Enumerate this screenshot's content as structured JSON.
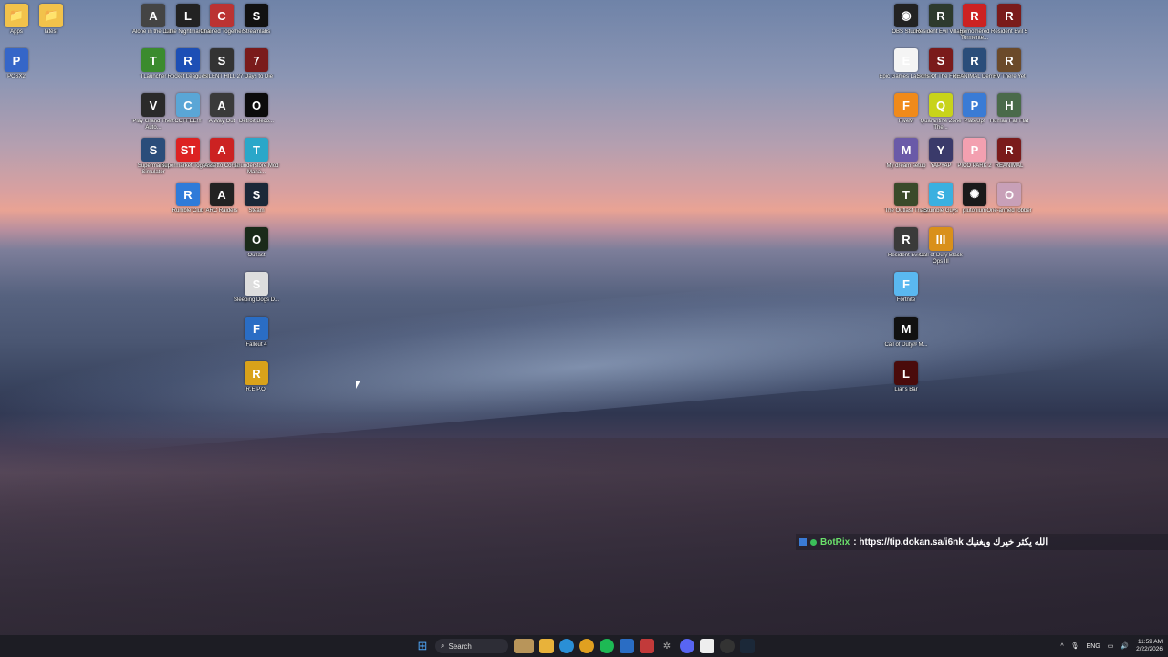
{
  "desktop": {
    "icons": [
      {
        "label": "Apps",
        "col": "#f2c24b",
        "glyph": "📁"
      },
      {
        "label": "latest",
        "col": "#f2c24b",
        "glyph": "📁"
      },
      {
        "label": "PCSX2",
        "col": "#3566c8",
        "glyph": "P"
      },
      {
        "label": "Alone in the Dark",
        "col": "#444",
        "glyph": "A"
      },
      {
        "label": "Little Nightmares II",
        "col": "#222",
        "glyph": "L"
      },
      {
        "label": "Chained Together",
        "col": "#b33",
        "glyph": "C"
      },
      {
        "label": "Streamlabs",
        "col": "#111",
        "glyph": "S"
      },
      {
        "label": "TLauncher",
        "col": "#3b8b2e",
        "glyph": "T"
      },
      {
        "label": "Rocket League®",
        "col": "#1d4fb5",
        "glyph": "R"
      },
      {
        "label": "SILENT HILL 2",
        "col": "#333",
        "glyph": "S"
      },
      {
        "label": "7 Days to Die",
        "col": "#7a1b1b",
        "glyph": "7"
      },
      {
        "label": "Play Grand Theft Auto...",
        "col": "#2a2a2a",
        "glyph": "V"
      },
      {
        "label": "COFFEE!!!",
        "col": "#5aa6d6",
        "glyph": "C"
      },
      {
        "label": "A Way Out",
        "col": "#3a3a3a",
        "glyph": "A"
      },
      {
        "label": "Detroit Beco...",
        "col": "#0b0b0b",
        "glyph": "O"
      },
      {
        "label": "Supermarket Simulator",
        "col": "#2a4d7a",
        "glyph": "S"
      },
      {
        "label": "Supermarket Together",
        "col": "#d22",
        "glyph": "ST"
      },
      {
        "label": "Assetto Corsa",
        "col": "#c22",
        "glyph": "A"
      },
      {
        "label": "Thunderstore Mod Mana...",
        "col": "#2aa7c9",
        "glyph": "T"
      },
      {
        "label": "Rumble Club",
        "col": "#2f7bd9",
        "glyph": "R"
      },
      {
        "label": "ARC Raiders",
        "col": "#222",
        "glyph": "A"
      },
      {
        "label": "Steam",
        "col": "#1b2838",
        "glyph": "S"
      },
      {
        "label": "Outlast",
        "col": "#1a2a1a",
        "glyph": "O"
      },
      {
        "label": "Sleeping Dogs D...",
        "col": "#ddd",
        "glyph": "S"
      },
      {
        "label": "Fallout 4",
        "col": "#2a6dc4",
        "glyph": "F"
      },
      {
        "label": "R.E.P.O.",
        "col": "#d9a21a",
        "glyph": "R"
      },
      {
        "label": "OBS Studio",
        "col": "#222",
        "glyph": "◉"
      },
      {
        "label": "Resident Evil Village",
        "col": "#2d3a2d",
        "glyph": "R"
      },
      {
        "label": "Remothered Tormente...",
        "col": "#c22",
        "glyph": "R"
      },
      {
        "label": "Resident Evil 5",
        "col": "#7a1b1b",
        "glyph": "R"
      },
      {
        "label": "Epic Games Launcher",
        "col": "#f4f4f4",
        "glyph": "E"
      },
      {
        "label": "Sons Of The Forest",
        "col": "#7a1b1b",
        "glyph": "S"
      },
      {
        "label": "REANIMAL Demo",
        "col": "#2a4d7a",
        "glyph": "R"
      },
      {
        "label": "RV There Yet",
        "col": "#6b4a2a",
        "glyph": "R"
      },
      {
        "label": "FiveM",
        "col": "#f08a1a",
        "glyph": "F"
      },
      {
        "label": "Quarantine Zone The...",
        "col": "#c8d31a",
        "glyph": "Q"
      },
      {
        "label": "PlateUp!",
        "col": "#3a7bd5",
        "glyph": "P"
      },
      {
        "label": "Human Fall Flat",
        "col": "#4a6a4a",
        "glyph": "H"
      },
      {
        "label": "My dream setup",
        "col": "#6a5aa8",
        "glyph": "M"
      },
      {
        "label": "YAPYAP",
        "col": "#3a3a6a",
        "glyph": "Y"
      },
      {
        "label": "PICO PARK 2",
        "col": "#f3a0b0",
        "glyph": "P"
      },
      {
        "label": "REANIMAL",
        "col": "#7a1b1b",
        "glyph": "R"
      },
      {
        "label": "The Outlast Trials",
        "col": "#3a4a2a",
        "glyph": "T"
      },
      {
        "label": "Stumble Guys",
        "col": "#3ab0e0",
        "glyph": "S"
      },
      {
        "label": "plutonium",
        "col": "#1a1a1a",
        "glyph": "✺"
      },
      {
        "label": "One-armed robber",
        "col": "#c8a0b8",
        "glyph": "O"
      },
      {
        "label": "Resident Evil 4",
        "col": "#3a3a3a",
        "glyph": "R"
      },
      {
        "label": "Call of Duty Black Ops III",
        "col": "#d9901a",
        "glyph": "III"
      },
      {
        "label": "Fortnite",
        "col": "#5ab8f0",
        "glyph": "F"
      },
      {
        "label": "Call of Duty® M...",
        "col": "#111",
        "glyph": "M"
      },
      {
        "label": "Liar's Bar",
        "col": "#4a0b0b",
        "glyph": "L"
      }
    ]
  },
  "chat_overlay": {
    "bot_name": "BotRix",
    "message": ": https://tip.dokan.sa/i6nk الله يكثر خيرك ويغنيك"
  },
  "taskbar": {
    "search_placeholder": "Search",
    "tray_lang": "ENG",
    "time": "11:59 AM",
    "date": "2/22/2026"
  }
}
